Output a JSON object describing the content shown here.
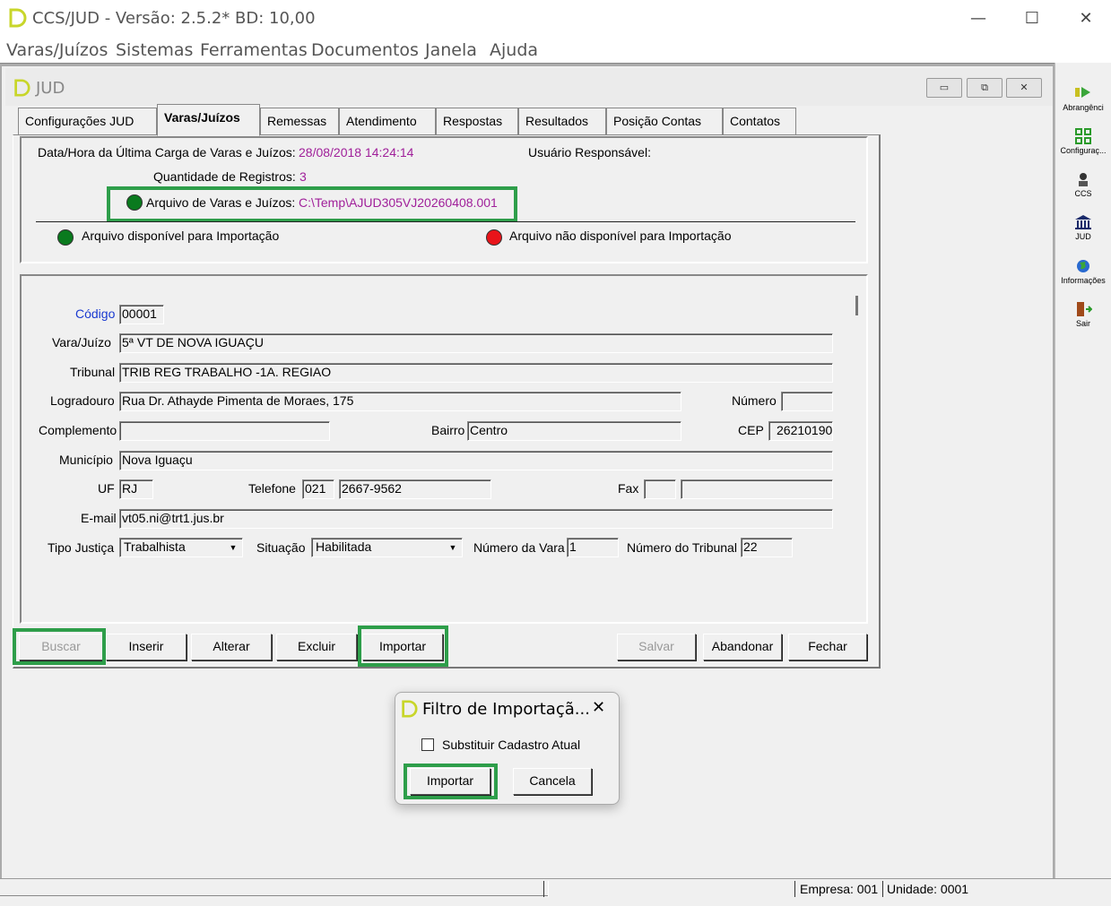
{
  "window": {
    "title": "CCS/JUD - Versão: 2.5.2* BD: 10,00",
    "controls": {
      "minimize": "—",
      "maximize": "☐",
      "close": "✕"
    }
  },
  "menu": [
    "Varas/Juízos",
    "Sistemas",
    "Ferramentas",
    "Documentos",
    "Janela",
    "Ajuda"
  ],
  "child": {
    "title": "JUD",
    "controls": {
      "minimize": "▭",
      "restore": "⧉",
      "close": "✕"
    }
  },
  "tabs": [
    "Configurações JUD",
    "Varas/Juízos",
    "Remessas",
    "Atendimento",
    "Respostas",
    "Resultados",
    "Posição Contas",
    "Contatos"
  ],
  "info": {
    "last_load_label": "Data/Hora da Última Carga de Varas e Juízos:",
    "last_load_value": "28/08/2018 14:24:14",
    "user_label": "Usuário Responsável:",
    "count_label": "Quantidade de Registros:",
    "count_value": "3",
    "file_label": "Arquivo de Varas e Juízos:",
    "file_value": "C:\\Temp\\AJUD305VJ20260408.001",
    "legend_available": "Arquivo disponível para Importação",
    "legend_unavailable": "Arquivo não disponível para Importação",
    "color_available": "#0a7a1e",
    "color_unavailable": "#e8141a"
  },
  "form": {
    "codigo_label": "Código",
    "codigo": "00001",
    "vara_label": "Vara/Juízo",
    "vara": "5ª VT DE NOVA IGUAÇU",
    "tribunal_label": "Tribunal",
    "tribunal": "TRIB REG TRABALHO -1A. REGIAO",
    "logradouro_label": "Logradouro",
    "logradouro": "Rua Dr. Athayde Pimenta de Moraes, 175",
    "numero_label": "Número",
    "numero": "",
    "complemento_label": "Complemento",
    "complemento": "",
    "bairro_label": "Bairro",
    "bairro": "Centro",
    "cep_label": "CEP",
    "cep": "26210190",
    "municipio_label": "Município",
    "municipio": "Nova Iguaçu",
    "uf_label": "UF",
    "uf": "RJ",
    "telefone_label": "Telefone",
    "telefone_ddd": "021",
    "telefone": "2667-9562",
    "fax_label": "Fax",
    "fax_ddd": "",
    "fax": "",
    "email_label": "E-mail",
    "email": "vt05.ni@trt1.jus.br",
    "tipo_justica_label": "Tipo Justiça",
    "tipo_justica": "Trabalhista",
    "situacao_label": "Situação",
    "situacao": "Habilitada",
    "numero_vara_label": "Número da Vara",
    "numero_vara": "1",
    "numero_tribunal_label": "Número do Tribunal",
    "numero_tribunal": "22"
  },
  "buttons": {
    "buscar": "Buscar",
    "inserir": "Inserir",
    "alterar": "Alterar",
    "excluir": "Excluir",
    "importar": "Importar",
    "salvar": "Salvar",
    "abandonar": "Abandonar",
    "fechar": "Fechar"
  },
  "toolbar": [
    {
      "label": "Abrangênci",
      "icon": "range-icon"
    },
    {
      "label": "Configuraç...",
      "icon": "config-icon"
    },
    {
      "label": "CCS",
      "icon": "ccs-icon"
    },
    {
      "label": "JUD",
      "icon": "bank-icon"
    },
    {
      "label": "Informações",
      "icon": "globe-icon"
    },
    {
      "label": "Sair",
      "icon": "exit-icon"
    }
  ],
  "dialog": {
    "title": "Filtro de Importaçã...",
    "checkbox_label": "Substituir Cadastro Atual",
    "checkbox_checked": false,
    "import_label": "Importar",
    "cancel_label": "Cancela"
  },
  "status": {
    "empresa": "Empresa: 001",
    "unidade": "Unidade: 0001"
  },
  "highlight_color": "#2e9e4a"
}
